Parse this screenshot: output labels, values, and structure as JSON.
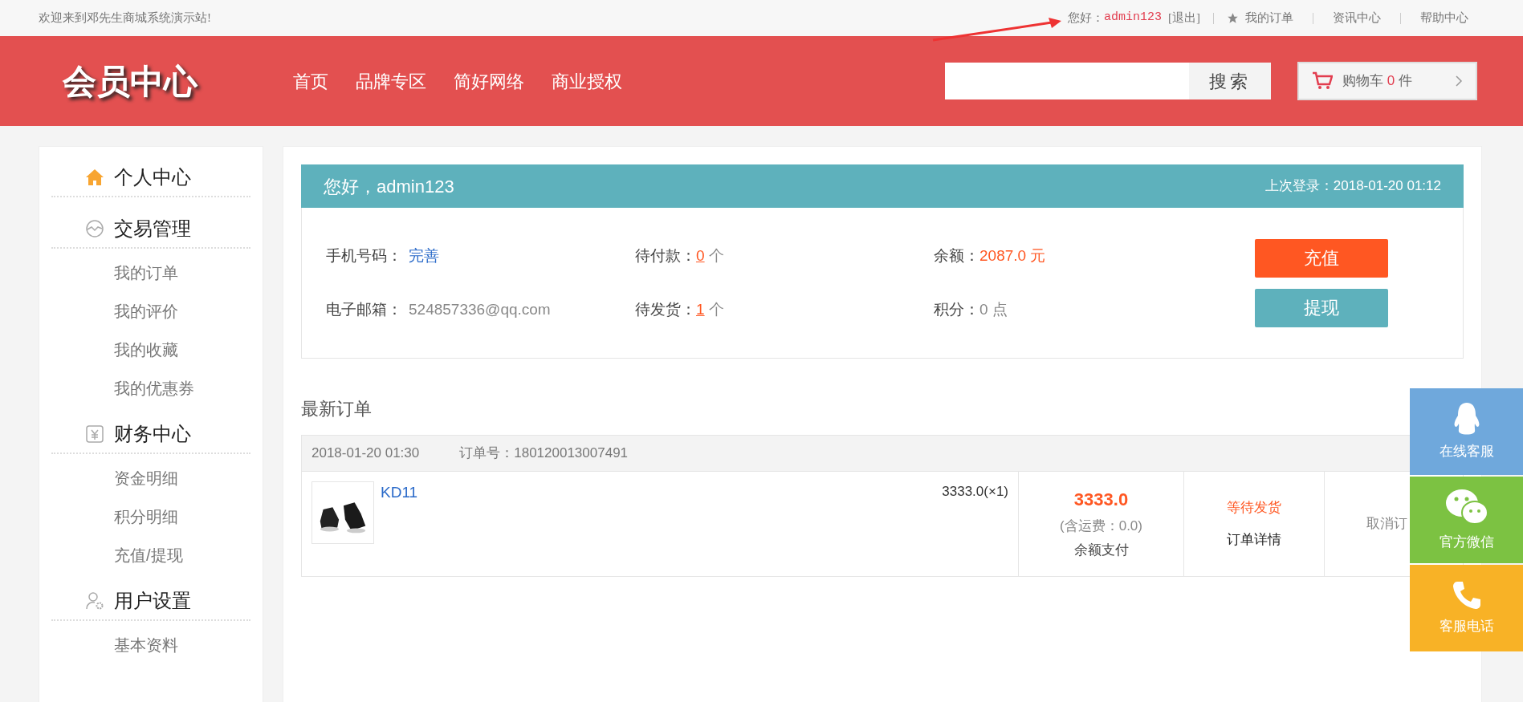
{
  "top_bar": {
    "welcome": "欢迎来到邓先生商城系统演示站!",
    "greeting_label": "您好：",
    "username": "admin123",
    "logout": "[退出]",
    "links": [
      "我的订单",
      "资讯中心",
      "帮助中心"
    ]
  },
  "header": {
    "logo": "会员中心",
    "nav": [
      "首页",
      "品牌专区",
      "简好网络",
      "商业授权"
    ],
    "search_button": "搜索",
    "cart": {
      "label": "购物车",
      "count": "0",
      "unit": "件"
    }
  },
  "sidebar": [
    {
      "title": "个人中心",
      "kind": "home"
    },
    {
      "title": "交易管理",
      "kind": "trade",
      "children": [
        "我的订单",
        "我的评价",
        "我的收藏",
        "我的优惠券"
      ]
    },
    {
      "title": "财务中心",
      "kind": "finance",
      "children": [
        "资金明细",
        "积分明细",
        "充值/提现"
      ]
    },
    {
      "title": "用户设置",
      "kind": "user",
      "children": [
        "基本资料"
      ]
    }
  ],
  "account": {
    "greeting": "您好，admin123",
    "last_login_label": "上次登录：",
    "last_login": "2018-01-20 01:12",
    "phone_label": "手机号码：",
    "phone_link": "完善",
    "email_label": "电子邮箱：",
    "email": "524857336@qq.com",
    "unpaid_label": "待付款：",
    "unpaid": "0",
    "unpaid_unit": "个",
    "unshipped_label": "待发货：",
    "unshipped": "1",
    "unshipped_unit": "个",
    "balance_label": "余额：",
    "balance": "2087.0 元",
    "points_label": "积分：",
    "points": "0 点",
    "recharge_button": "充值",
    "withdraw_button": "提现"
  },
  "latest_orders": {
    "title": "最新订单",
    "orders": [
      {
        "date": "2018-01-20 01:30",
        "order_no_label": "订单号：",
        "order_no": "180120013007491",
        "product": "KD11",
        "price_qty": "3333.0(×1)",
        "total": "3333.0",
        "shipping": "(含运费：0.0)",
        "payment": "余额支付",
        "status": "等待发货",
        "details": "订单详情",
        "cancel": "取消订"
      }
    ]
  },
  "float_buttons": [
    {
      "label": "在线客服",
      "kind": "qq",
      "color": "#6fa8dc"
    },
    {
      "label": "官方微信",
      "kind": "wechat",
      "color": "#7cc242"
    },
    {
      "label": "客服电话",
      "kind": "phone",
      "color": "#f8b226"
    }
  ]
}
